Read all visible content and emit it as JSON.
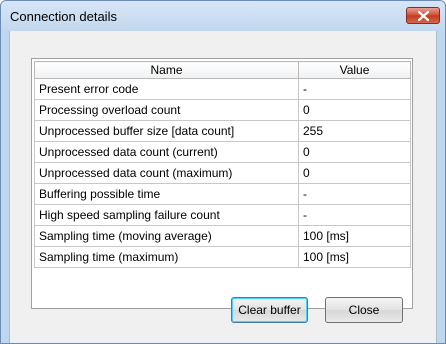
{
  "window": {
    "title": "Connection details"
  },
  "table": {
    "headers": {
      "name": "Name",
      "value": "Value"
    },
    "rows": [
      {
        "name": "Present error code",
        "value": "-"
      },
      {
        "name": "Processing overload count",
        "value": "0"
      },
      {
        "name": "Unprocessed buffer size [data count]",
        "value": "255"
      },
      {
        "name": "Unprocessed data count (current)",
        "value": "0"
      },
      {
        "name": "Unprocessed data count (maximum)",
        "value": "0"
      },
      {
        "name": "Buffering possible time",
        "value": "-"
      },
      {
        "name": "High speed sampling failure count",
        "value": "-"
      },
      {
        "name": "Sampling time (moving average)",
        "value": "100 [ms]"
      },
      {
        "name": "Sampling time (maximum)",
        "value": "100 [ms]"
      }
    ]
  },
  "buttons": {
    "clear_buffer": "Clear buffer",
    "close": "Close"
  },
  "colors": {
    "title_bar": "#c2d7ee",
    "close_button": "#c23a22",
    "dialog_bg": "#f0f0f0"
  }
}
